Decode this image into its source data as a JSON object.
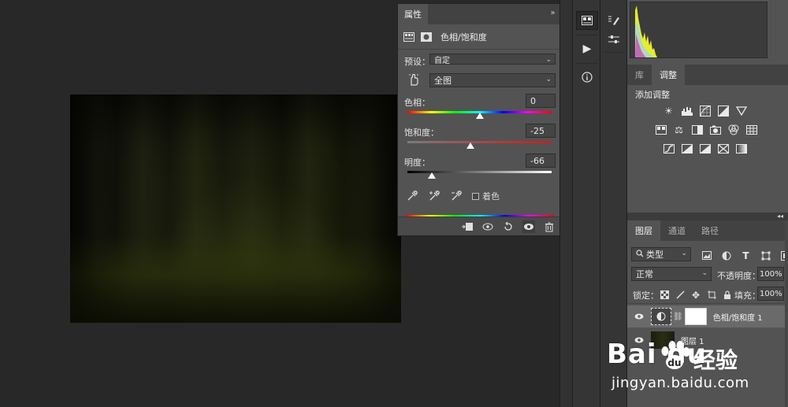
{
  "properties_panel": {
    "tab_label": "属性",
    "collapse_glyph": "»",
    "menu_glyph": "≡",
    "adjustment_name": "色相/饱和度",
    "preset_label": "预设：",
    "preset_value": "自定",
    "channel_value": "全图",
    "hue_label": "色相：",
    "hue_value": "0",
    "saturation_label": "饱和度：",
    "saturation_value": "-25",
    "lightness_label": "明度：",
    "lightness_value": "-66",
    "colorize_label": "着色",
    "hue_level": 0.5,
    "saturation_level": 0.4375,
    "lightness_level": 0.17
  },
  "right_panel": {
    "tabs_top": [
      "库",
      "调整"
    ],
    "active_top_tab": "调整",
    "adjustments_title": "添加调整",
    "tabs_layers": [
      "图层",
      "通道",
      "路径"
    ],
    "active_layer_tab": "图层",
    "filter_kind": "类型",
    "blend_mode": "正常",
    "opacity_label": "不透明度：",
    "opacity_value": "100%",
    "lock_label": "锁定：",
    "fill_label": "填充：",
    "fill_value": "100%",
    "layers": [
      {
        "name": "色相/饱和度 1"
      },
      {
        "name": "图层 1"
      }
    ]
  },
  "watermark": {
    "logo": "Bai  du",
    "brand_cn": "经验",
    "url": "jingyan.baidu.com"
  },
  "colors": {
    "panel_bg": "#535353",
    "tabbar_bg": "#424242",
    "canvas_bg": "#282828",
    "accent_histogram": "#e6ee2a"
  }
}
